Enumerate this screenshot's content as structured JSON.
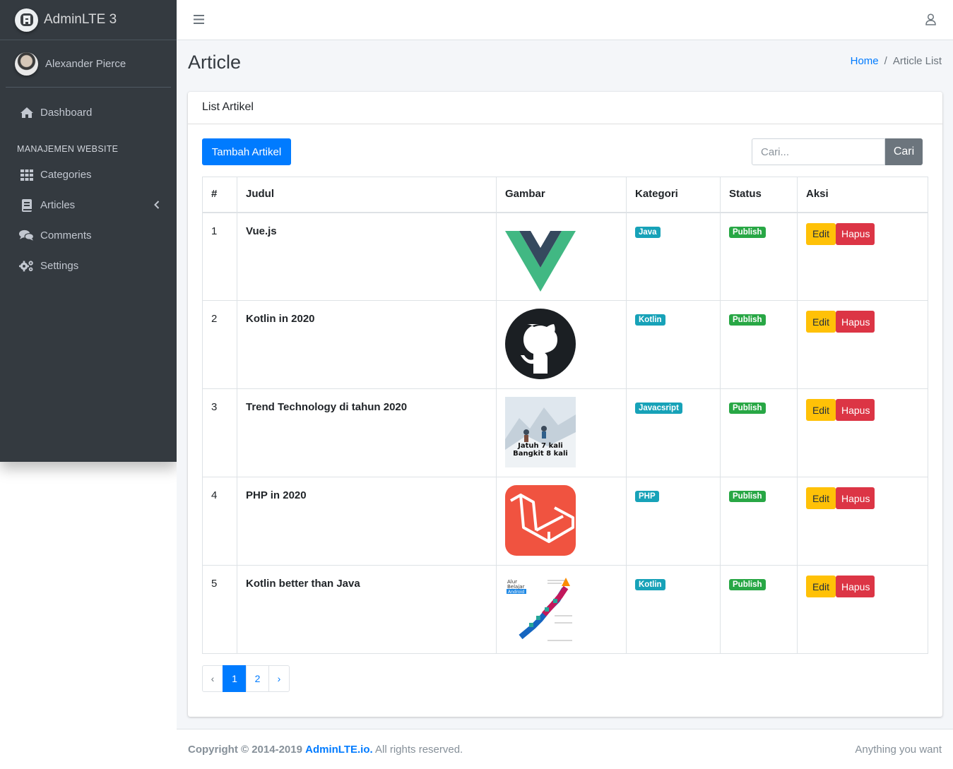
{
  "brand": {
    "name": "AdminLTE 3",
    "logo_letter": "A"
  },
  "user": {
    "name": "Alexander Pierce"
  },
  "sidebar": {
    "items_top": [
      {
        "label": "Dashboard",
        "icon": "home-icon"
      }
    ],
    "header": "MANAJEMEN WEBSITE",
    "items": [
      {
        "label": "Categories",
        "icon": "grid-icon"
      },
      {
        "label": "Articles",
        "icon": "book-icon"
      },
      {
        "label": "Comments",
        "icon": "comments-icon"
      },
      {
        "label": "Settings",
        "icon": "gears-icon"
      }
    ]
  },
  "page": {
    "title": "Article"
  },
  "breadcrumb": {
    "home": "Home",
    "separator": "/",
    "current": "Article List"
  },
  "card": {
    "title": "List Artikel",
    "add_button": "Tambah Artikel"
  },
  "search": {
    "placeholder": "Cari...",
    "button": "Cari"
  },
  "table": {
    "headers": {
      "num": "#",
      "title": "Judul",
      "image": "Gambar",
      "category": "Kategori",
      "status": "Status",
      "action": "Aksi"
    },
    "rows": [
      {
        "num": "1",
        "title": "Vue.js",
        "image": "vue-logo",
        "category": "Java",
        "status": "Publish"
      },
      {
        "num": "2",
        "title": "Kotlin in 2020",
        "image": "github-logo",
        "category": "Kotlin",
        "status": "Publish"
      },
      {
        "num": "3",
        "title": "Trend Technology di tahun 2020",
        "image": "mountain-poster",
        "poster_text": [
          "Jatuh 7 kali",
          "Bangkit 8 kali"
        ],
        "category": "Javacsript",
        "status": "Publish"
      },
      {
        "num": "4",
        "title": "PHP in 2020",
        "image": "laravel-logo",
        "category": "PHP",
        "status": "Publish"
      },
      {
        "num": "5",
        "title": "Kotlin better than Java",
        "image": "android-roadmap",
        "poster_text": [
          "Alur",
          "Belajar",
          "Android"
        ],
        "category": "Kotlin",
        "status": "Publish"
      }
    ],
    "edit_label": "Edit",
    "delete_label": "Hapus"
  },
  "pagination": {
    "prev": "‹",
    "pages": [
      "1",
      "2"
    ],
    "next": "›",
    "active": "1"
  },
  "footer": {
    "copyright": "Copyright © 2014-2019",
    "link": "AdminLTE.io.",
    "rights": "All rights reserved.",
    "right_text": "Anything you want"
  },
  "colors": {
    "primary": "#007bff",
    "info": "#17a2b8",
    "success": "#28a745",
    "warning": "#ffc107",
    "danger": "#dc3545",
    "sidebar": "#343a40"
  }
}
